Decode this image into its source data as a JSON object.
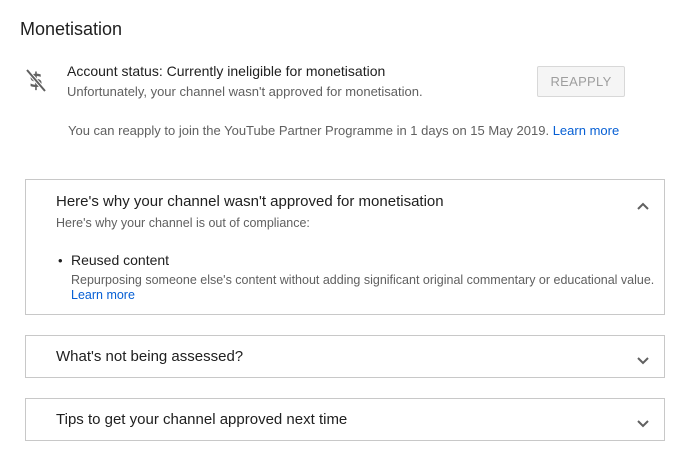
{
  "page": {
    "title": "Monetisation"
  },
  "status": {
    "icon": "no-money-icon",
    "main": "Account status: Currently ineligible for monetisation",
    "sub": "Unfortunately, your channel wasn't approved for monetisation.",
    "reapply_label": "REAPPLY",
    "reapply_info": "You can reapply to join the YouTube Partner Programme in 1 days on 15 May 2019.",
    "learn_more": "Learn more"
  },
  "panels": [
    {
      "heading": "Here's why your channel wasn't approved for monetisation",
      "expanded": true,
      "subtitle": "Here's why your channel is out of compliance:",
      "reasons": [
        {
          "title": "Reused content",
          "description": "Repurposing someone else's content without adding significant original commentary or educational value.",
          "learn_more": "Learn more"
        }
      ]
    },
    {
      "heading": "What's not being assessed?",
      "expanded": false
    },
    {
      "heading": "Tips to get your channel approved next time",
      "expanded": false
    }
  ],
  "colors": {
    "link": "#065fd4",
    "border": "#c8c8c8",
    "secondary_text": "#606060"
  }
}
